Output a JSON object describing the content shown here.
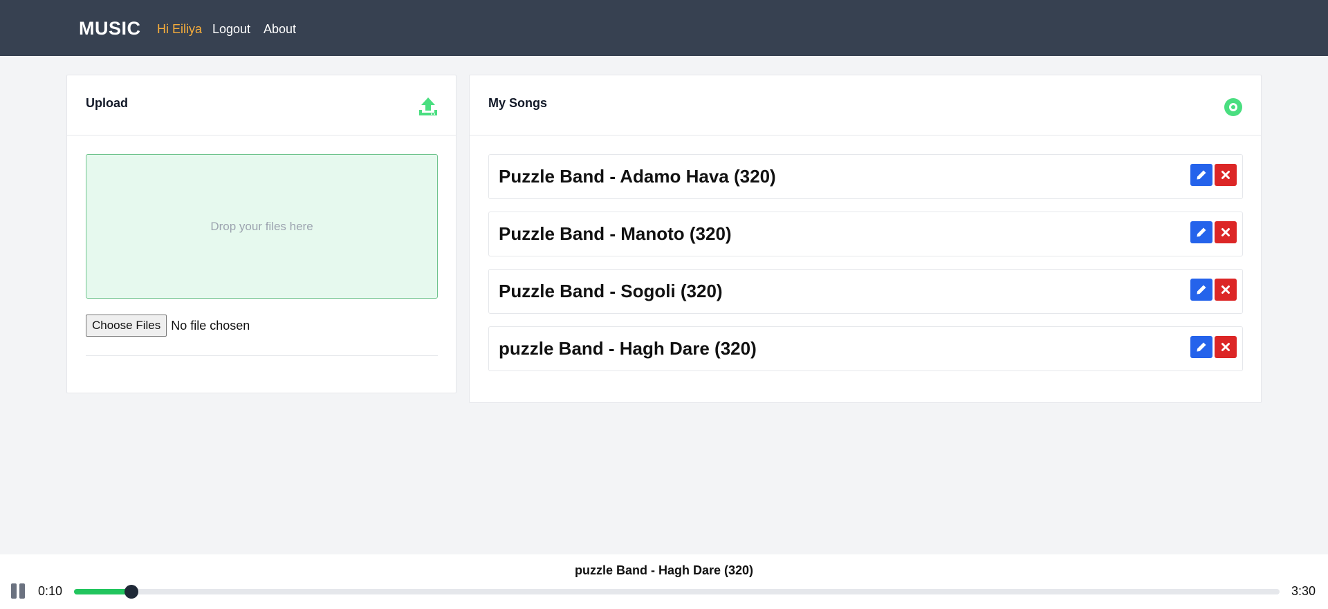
{
  "header": {
    "brand": "MUSIC",
    "greeting": "Hi Eiliya",
    "logout": "Logout",
    "about": "About"
  },
  "upload": {
    "title": "Upload",
    "icon": "upload-icon",
    "dropzone_text": "Drop your files here",
    "choose_files": "Choose Files",
    "file_status": "No file chosen"
  },
  "songs": {
    "title": "My Songs",
    "icon": "disc-icon",
    "items": [
      {
        "title": "Puzzle Band - Adamo Hava (320)"
      },
      {
        "title": "Puzzle Band - Manoto (320)"
      },
      {
        "title": "Puzzle Band - Sogoli (320)"
      },
      {
        "title": "puzzle Band - Hagh Dare (320)"
      }
    ]
  },
  "player": {
    "now_playing": "puzzle Band - Hagh Dare (320)",
    "current_time": "0:10",
    "total_time": "3:30",
    "progress": 0.0476
  },
  "colors": {
    "header_bg": "#374151",
    "accent_green": "#22c55e",
    "edit_blue": "#2563eb",
    "delete_red": "#dc2626",
    "greeting": "#f6ad3b"
  }
}
